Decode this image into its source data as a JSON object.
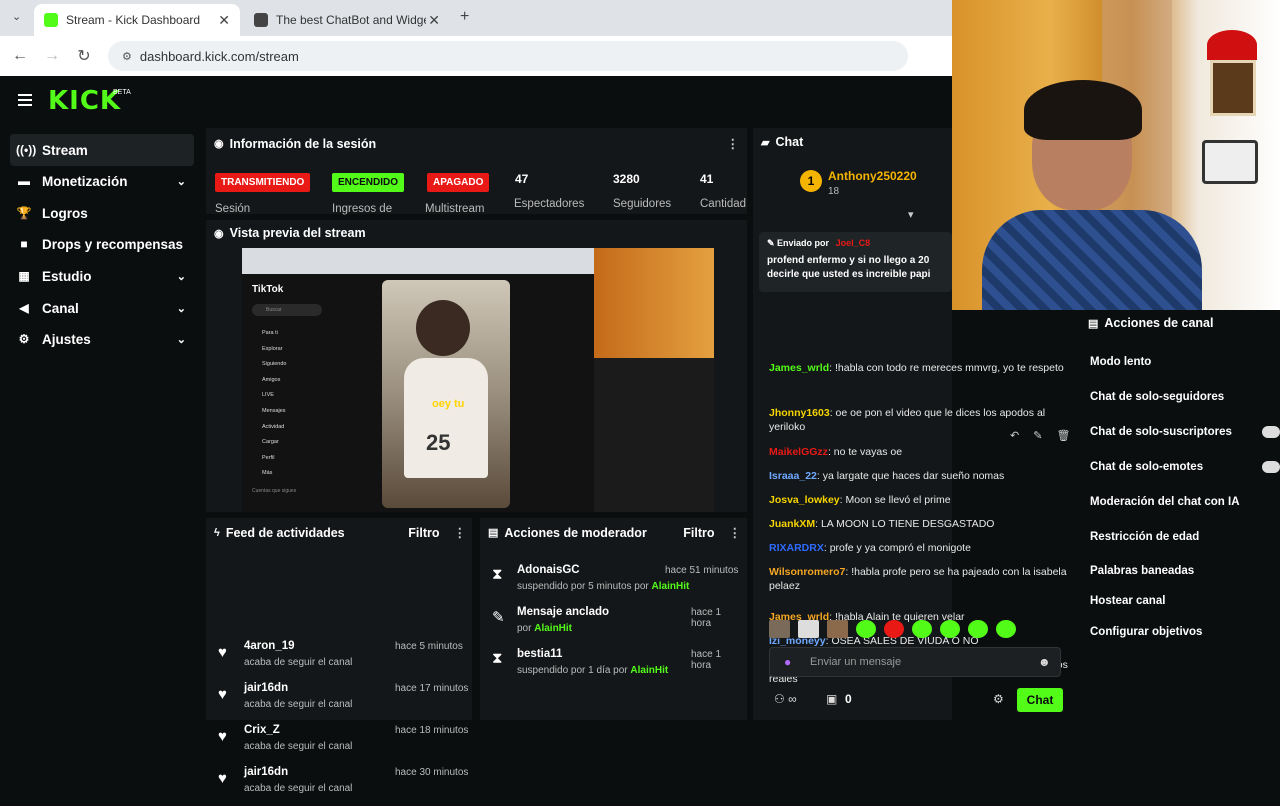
{
  "browser": {
    "tabs": [
      {
        "title": "Stream - Kick Dashboard"
      },
      {
        "title": "The best ChatBot and Widgets"
      }
    ],
    "url": "dashboard.kick.com/stream"
  },
  "app": {
    "logo": "KICK",
    "logo_badge": "BETA"
  },
  "sidebar": {
    "items": [
      {
        "label": "Stream",
        "icon": "broadcast-icon"
      },
      {
        "label": "Monetización",
        "icon": "wallet-icon"
      },
      {
        "label": "Logros",
        "icon": "trophy-icon"
      },
      {
        "label": "Drops y recompensas",
        "icon": "gift-icon"
      },
      {
        "label": "Estudio",
        "icon": "grid-icon"
      },
      {
        "label": "Canal",
        "icon": "megaphone-icon"
      },
      {
        "label": "Ajustes",
        "icon": "gear-icon"
      }
    ]
  },
  "session": {
    "title": "Información de la sesión",
    "badges": [
      {
        "label": "TRANSMITIENDO",
        "sub": "Sesión",
        "color": "#e91916"
      },
      {
        "label": "ENCENDIDO",
        "sub": "Ingresos de",
        "color": "#53fc18"
      },
      {
        "label": "APAGADO",
        "sub": "Multistream",
        "color": "#e91916"
      }
    ],
    "stats": [
      {
        "value": "47",
        "label": "Espectadores"
      },
      {
        "value": "3280",
        "label": "Seguidores"
      },
      {
        "value": "41",
        "label": "Cantidad"
      }
    ]
  },
  "preview": {
    "title": "Vista previa del stream",
    "tiktok_label": "TikTok",
    "tiktok_search": "Buscar",
    "tiktok_menu": [
      "Para ti",
      "Explorar",
      "Siguiendo",
      "Amigos",
      "LIVE",
      "Mensajes",
      "Actividad",
      "Cargar",
      "Perfil",
      "Más"
    ],
    "tiktok_follow_label": "Cuentas que sigues",
    "video_caption": "oey tu",
    "jersey_number": "25"
  },
  "feed": {
    "title": "Feed de actividades",
    "filter": "Filtro",
    "items": [
      {
        "name": "4aron_19",
        "action": "acaba de seguir el canal",
        "time": "hace 5 minutos"
      },
      {
        "name": "jair16dn",
        "action": "acaba de seguir el canal",
        "time": "hace 17 minutos"
      },
      {
        "name": "Crix_Z",
        "action": "acaba de seguir el canal",
        "time": "hace 18 minutos"
      },
      {
        "name": "jair16dn",
        "action": "acaba de seguir el canal",
        "time": "hace 30 minutos"
      }
    ]
  },
  "mod": {
    "title": "Acciones de moderador",
    "filter": "Filtro",
    "items": [
      {
        "name": "AdonaisGC",
        "action": "suspendido por 5 minutos por",
        "by": "AlainHit",
        "time": "hace 51 minutos",
        "icon": "hourglass-icon"
      },
      {
        "name": "Mensaje anclado",
        "action": "por",
        "by": "AlainHit",
        "time": "hace 1 hora",
        "icon": "pin-icon"
      },
      {
        "name": "bestia11",
        "action": "suspendido por 1 día por",
        "by": "AlainHit",
        "time": "hace 1 hora",
        "icon": "hourglass-icon"
      }
    ]
  },
  "chat": {
    "title": "Chat",
    "top_user": {
      "name": "Anthony250220",
      "rank": "1",
      "count": "18"
    },
    "pinned": {
      "label": "Enviado por",
      "by": "Joel_C8",
      "text": "profend enfermo y si no llego a 20 decirle que usted es increible papi"
    },
    "messages": [
      {
        "user": "James_wrld",
        "text": "!habla con todo re mereces mmvrg, yo te respeto",
        "color": "#53fc18"
      },
      {
        "user": "Jhonny1603",
        "text": "oe oe pon el video que le dices los apodos al yeriloko",
        "color": "#f5d400"
      },
      {
        "user": "MaikelGGzz",
        "text": "no te vayas oe",
        "color": "#e91916"
      },
      {
        "user": "Israaa_22",
        "text": "ya largate que haces dar sueño nomas",
        "color": "#6fa8ff"
      },
      {
        "user": "Josva_lowkey",
        "text": "Moon se llevó el prime",
        "color": "#f5d400"
      },
      {
        "user": "JuankXM",
        "text": "LA MOON LO TIENE DESGASTADO",
        "color": "#f5d400"
      },
      {
        "user": "RIXARDRX",
        "text": "profe y ya compró el monigote",
        "color": "#2f6bff"
      },
      {
        "user": "Wilsonromero7",
        "text": "!habla profe pero se ha pajeado con la isabela pelaez",
        "color": "#f5a623"
      },
      {
        "user": "James_wrld",
        "text": "!habla Alain te quieren velar",
        "color": "#f5a623"
      },
      {
        "user": "Izi_moneyy",
        "text": "OSEA SALES DE VIUDA O NO",
        "color": "#6fa8ff"
      },
      {
        "user": "Jerx_cf",
        "text": "!habla Profe cuando un among us pero sin ratas, puros reales",
        "color": "#b36bff"
      }
    ],
    "input_placeholder": "Enviar un mensaje",
    "footer_count": "0",
    "send_label": "Chat"
  },
  "channel_actions": {
    "title": "Acciones de canal",
    "items": [
      {
        "label": "Modo lento",
        "toggle": false
      },
      {
        "label": "Chat de solo-seguidores",
        "toggle": false
      },
      {
        "label": "Chat de solo-suscriptores",
        "toggle": true
      },
      {
        "label": "Chat de solo-emotes",
        "toggle": true
      },
      {
        "label": "Moderación del chat con IA",
        "toggle": false
      },
      {
        "label": "Restricción de edad",
        "toggle": false
      },
      {
        "label": "Palabras baneadas",
        "toggle": false
      },
      {
        "label": "Hostear canal",
        "toggle": false
      },
      {
        "label": "Configurar objetivos",
        "toggle": false
      }
    ]
  },
  "colors": {
    "kick_green": "#53fc18",
    "live_red": "#e91916",
    "panel": "#141719"
  }
}
